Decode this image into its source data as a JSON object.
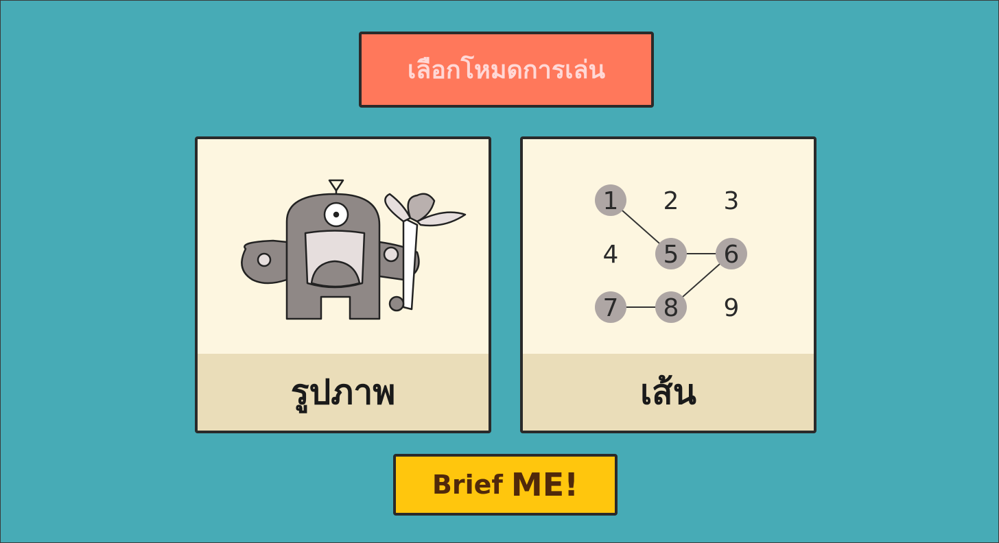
{
  "title": "เลือกโหมดการเล่น",
  "modes": [
    {
      "label": "รูปภาพ",
      "icon": "monster-picture-icon"
    },
    {
      "label": "เส้น",
      "icon": "pattern-grid-icon",
      "grid_numbers": [
        "1",
        "2",
        "3",
        "4",
        "5",
        "6",
        "7",
        "8",
        "9"
      ],
      "path": [
        1,
        5,
        6,
        8,
        7
      ]
    }
  ],
  "brief_button": {
    "part1": "Brief",
    "part2": "ME!"
  },
  "colors": {
    "background": "#47abb6",
    "title_bg": "#ff785b",
    "card_bg": "#fdf6e0",
    "card_band": "#eaddb9",
    "button_bg": "#ffc60d"
  }
}
